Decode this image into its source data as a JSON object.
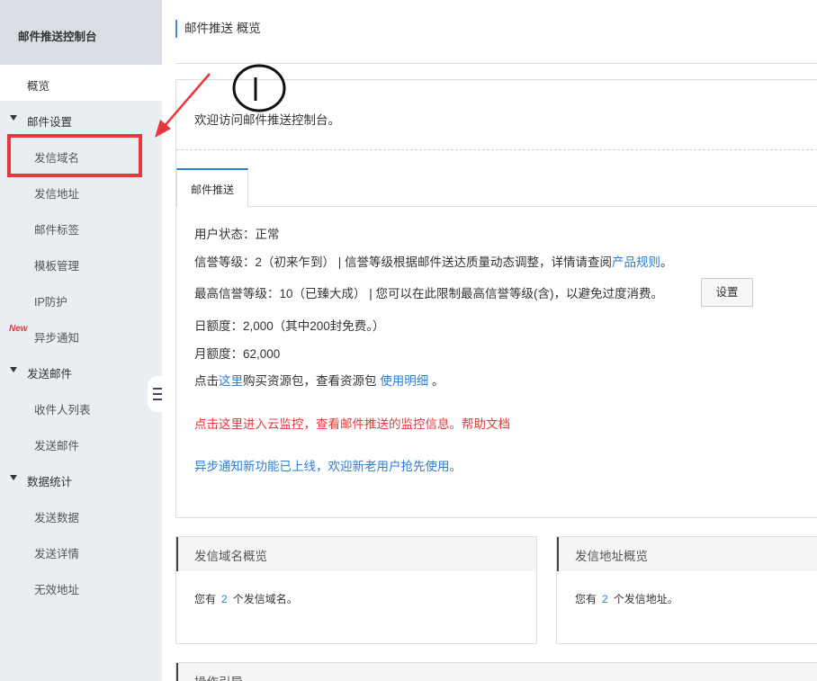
{
  "sidebar": {
    "title": "邮件推送控制台",
    "overview": "概览",
    "groups": [
      {
        "label": "邮件设置",
        "items": [
          "发信域名",
          "发信地址",
          "邮件标签",
          "模板管理",
          "IP防护",
          "异步通知"
        ]
      },
      {
        "label": "发送邮件",
        "items": [
          "收件人列表",
          "发送邮件"
        ]
      },
      {
        "label": "数据统计",
        "items": [
          "发送数据",
          "发送详情",
          "无效地址"
        ]
      }
    ],
    "new_badge": "New"
  },
  "header": {
    "breadcrumb": "邮件推送 概览"
  },
  "overview": {
    "welcome": "欢迎访问邮件推送控制台。",
    "tab": "邮件推送",
    "user_status": "用户状态：正常",
    "credit_level_text": "信誉等级：2（初来乍到） | 信誉等级根据邮件送达质量动态调整，详情请查阅",
    "credit_level_link": "产品规则",
    "credit_level_end": "。",
    "max_level": "最高信誉等级：10（已臻大成） | 您可以在此限制最高信誉等级(含)，以避免过度消费。",
    "settings_btn": "设置",
    "daily_quota": "日额度：2,000（其中200封免费。）",
    "monthly_quota": "月额度：62,000",
    "buy_prefix": "点击",
    "buy_link": "这里",
    "buy_mid": "购买资源包，查看资源包 ",
    "usage_link": "使用明细",
    "buy_end": " 。",
    "monitor_text": "点击这里进入云监控，查看邮件推送的监控信息。帮助文档",
    "async_notice": "异步通知新功能已上线，欢迎新老用户抢先使用。"
  },
  "cards": {
    "domain": {
      "title": "发信域名概览",
      "prefix": "您有",
      "count": "2",
      "suffix": "个发信域名。"
    },
    "address": {
      "title": "发信地址概览",
      "prefix": "您有",
      "count": "2",
      "suffix": "个发信地址。"
    },
    "guide": {
      "title": "操作引导"
    }
  },
  "annotation": {
    "marker": "①"
  },
  "colors": {
    "accent": "#2e7ed6",
    "alert": "#e4393c",
    "sidebar_bg": "#eaedf1"
  }
}
